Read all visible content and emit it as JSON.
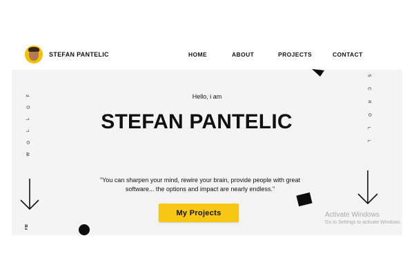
{
  "header": {
    "brand_name": "STEFAN PANTELIC",
    "avatar_icon": "person-avatar-icon",
    "nav": [
      "HOME",
      "ABOUT",
      "PROJECTS",
      "CONTACT"
    ]
  },
  "hero": {
    "greeting": "Hello, i am",
    "title": "STEFAN PANTELIC",
    "quote": "\"You can sharpen your mind, rewire your brain, provide people with great software... the options and impact are nearly endless.\"",
    "cta_label": "My Projects",
    "side_left_letters": [
      "F",
      "O",
      "L",
      "L",
      "O",
      "W"
    ],
    "side_right_letters": [
      "S",
      "C",
      "R",
      "O",
      "L",
      "L"
    ],
    "fb_label": "FB",
    "arrow_icon": "arrow-down-icon"
  },
  "overlay": {
    "activate_title": "Activate Windows",
    "activate_sub": "Go to Settings to activate Windows."
  },
  "colors": {
    "accent": "#f7c613",
    "hero_bg": "#f4f4f4",
    "text": "#111111"
  }
}
